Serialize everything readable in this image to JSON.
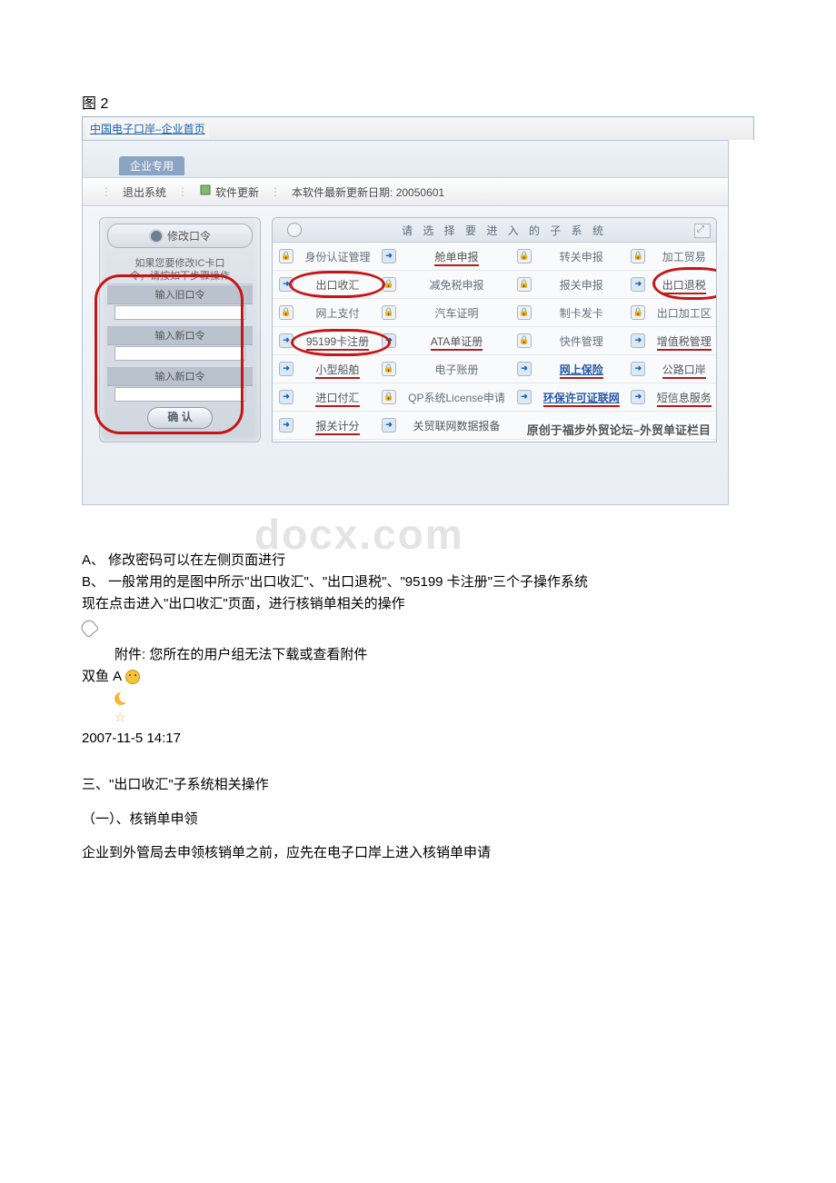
{
  "figure_label": "图 2",
  "browser_title": "中国电子口岸–企业首页",
  "top_tag": "企业专用",
  "toolbar": {
    "exit": "退出系统",
    "update": "软件更新",
    "update_date": "本软件最新更新日期: 20050601"
  },
  "left_panel": {
    "change_pw": "修改口令",
    "note_line1": "如果您要修改IC卡口",
    "note_line2": "令，请按如下步骤操作",
    "old_pw": "输入旧口令",
    "new_pw": "输入新口令",
    "new_pw_again": "输入新口令",
    "confirm": "确 认"
  },
  "right_panel": {
    "header": "请 选 择 要 进 入 的 子 系 统",
    "rows": [
      [
        {
          "icon": "lock",
          "label": "身份认证管理",
          "style": "plain"
        },
        {
          "icon": "arrow",
          "label": "舱单申报",
          "style": "redlink underline-red"
        },
        {
          "icon": "lock",
          "label": "转关申报",
          "style": "plain"
        },
        {
          "icon": "lock",
          "label": "加工贸易",
          "style": "plain"
        }
      ],
      [
        {
          "icon": "arrow",
          "label": "出口收汇",
          "style": "redlink",
          "circled": "c1"
        },
        {
          "icon": "lock",
          "label": "减免税申报",
          "style": "plain"
        },
        {
          "icon": "lock",
          "label": "报关申报",
          "style": "plain"
        },
        {
          "icon": "arrow",
          "label": "出口退税",
          "style": "redlink underline-red",
          "circled": "c2"
        }
      ],
      [
        {
          "icon": "lock",
          "label": "网上支付",
          "style": "plain"
        },
        {
          "icon": "lock",
          "label": "汽车证明",
          "style": "plain"
        },
        {
          "icon": "lock",
          "label": "制卡发卡",
          "style": "plain"
        },
        {
          "icon": "lock",
          "label": "出口加工区",
          "style": "plain"
        }
      ],
      [
        {
          "icon": "arrow",
          "label": "95199卡注册",
          "style": "redlink underline-red",
          "circled": "c3"
        },
        {
          "icon": "arrow",
          "label": "ATA单证册",
          "style": "redlink underline-red"
        },
        {
          "icon": "lock",
          "label": "快件管理",
          "style": "plain"
        },
        {
          "icon": "arrow",
          "label": "增值税管理",
          "style": "redlink underline-red"
        }
      ],
      [
        {
          "icon": "arrow",
          "label": "小型船舶",
          "style": "redlink underline-red"
        },
        {
          "icon": "lock",
          "label": "电子账册",
          "style": "plain"
        },
        {
          "icon": "arrow",
          "label": "网上保险",
          "style": "bluelink underline-red"
        },
        {
          "icon": "arrow",
          "label": "公路口岸",
          "style": "redlink underline-red"
        }
      ],
      [
        {
          "icon": "arrow",
          "label": "进口付汇",
          "style": "redlink underline-red"
        },
        {
          "icon": "lock",
          "label": "QP系统License申请",
          "style": "plain"
        },
        {
          "icon": "arrow",
          "label": "环保许可证联网",
          "style": "bluelink underline-red"
        },
        {
          "icon": "arrow",
          "label": "短信息服务",
          "style": "redlink underline-red"
        }
      ],
      [
        {
          "icon": "arrow",
          "label": "报关计分",
          "style": "redlink underline-red"
        },
        {
          "icon": "arrow",
          "label": "关贸联网数据报备",
          "style": "redlink"
        },
        {
          "icon": "",
          "label": "",
          "style": ""
        },
        {
          "icon": "",
          "label": "",
          "style": ""
        }
      ]
    ],
    "credit": "原创于福步外贸论坛–外贸单证栏目"
  },
  "body": {
    "lineA": "A、        修改密码可以在左侧页面进行",
    "lineB": "B、        一般常用的是图中所示\"出口收汇\"、\"出口退税\"、\"95199 卡注册\"三个子操作系统",
    "lineC": "现在点击进入\"出口收汇\"页面，进行核销单相关的操作",
    "attach_label": "附件: 您所在的用户组无法下载或查看附件",
    "user": "双鱼 A",
    "date": "2007-11-5 14:17"
  },
  "section3": {
    "l1": "三、\"出口收汇\"子系统相关操作",
    "l2": "（一）、核销单申领",
    "l3": "企业到外管局去申领核销单之前，应先在电子口岸上进入核销单申请"
  },
  "watermark": "docx.com"
}
